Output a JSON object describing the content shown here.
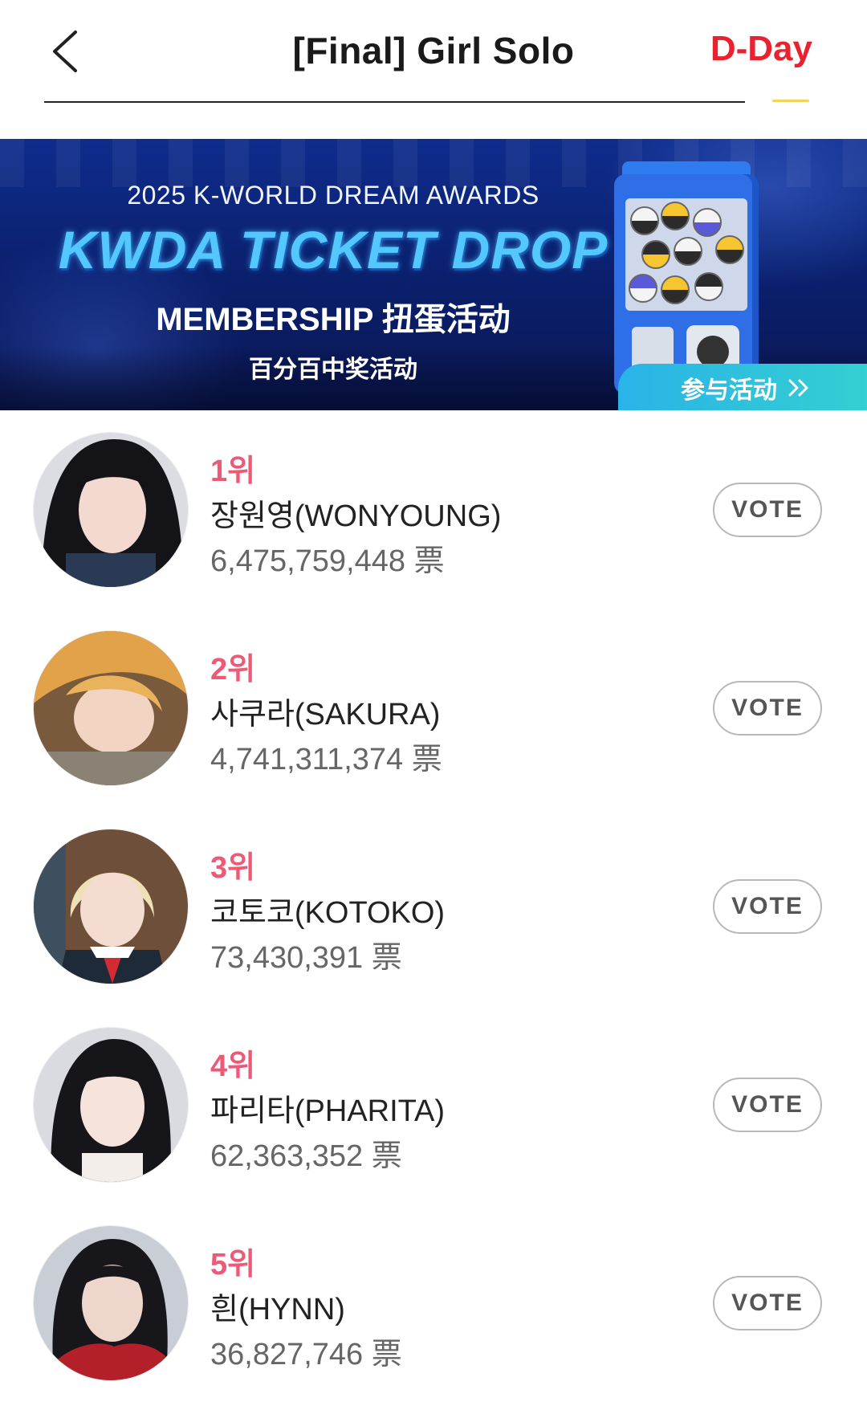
{
  "header": {
    "title": "[Final] Girl Solo",
    "dday_label": "D-Day",
    "back_icon": "chevron-left-icon",
    "accent_color": "#e8222e"
  },
  "banner": {
    "year_line": "2025 K-WORLD DREAM AWARDS",
    "title_line": "KWDA TICKET DROP",
    "membership_line": "MEMBERSHIP 扭蛋活动",
    "sub_line": "百分百中奖活动",
    "join_label": "参与活动",
    "join_icon": "double-chevron-right-icon",
    "illustration": "gacha-machine-icon"
  },
  "rank_color": "#ec5a78",
  "ranking": [
    {
      "rank": "1위",
      "name": "장원영(WONYOUNG)",
      "votes": "6,475,759,448 票",
      "vote_label": "VOTE"
    },
    {
      "rank": "2위",
      "name": "사쿠라(SAKURA)",
      "votes": "4,741,311,374 票",
      "vote_label": "VOTE"
    },
    {
      "rank": "3위",
      "name": "코토코(KOTOKO)",
      "votes": "73,430,391 票",
      "vote_label": "VOTE"
    },
    {
      "rank": "4위",
      "name": "파리타(PHARITA)",
      "votes": "62,363,352 票",
      "vote_label": "VOTE"
    },
    {
      "rank": "5위",
      "name": "흰(HYNN)",
      "votes": "36,827,746 票",
      "vote_label": "VOTE"
    }
  ]
}
